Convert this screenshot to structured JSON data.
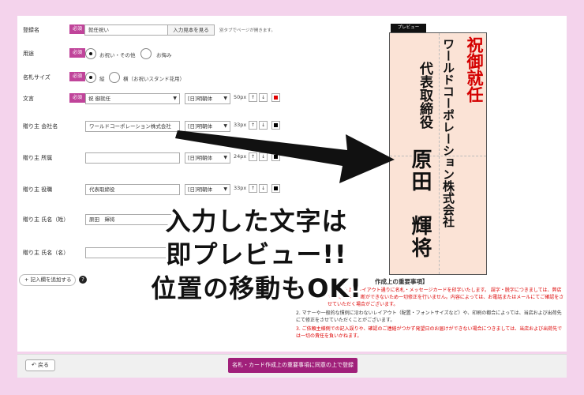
{
  "form": {
    "required": "必須",
    "rows": [
      {
        "label": "登録名",
        "required": true,
        "value": "就任祝い",
        "button": "入力見本を見る",
        "note": "別タブでページが開きます。"
      },
      {
        "label": "用途",
        "required": true,
        "options": [
          "お祝い・その他",
          "お悔み"
        ],
        "selected": 0
      },
      {
        "label": "名札サイズ",
        "required": true,
        "options": [
          "縦",
          "横（お祝いスタンド花用）"
        ],
        "selected": 0
      },
      {
        "label": "文言",
        "required": true,
        "value": "祝 御就任",
        "font": "[日]明朝体",
        "size": "50px",
        "color": "#e00000"
      },
      {
        "label": "贈り主 会社名",
        "required": false,
        "value": "ワールドコーポレーション株式会社",
        "font": "[日]明朝体",
        "size": "33px",
        "color": "#000000"
      },
      {
        "label": "贈り主 所属",
        "required": false,
        "value": "",
        "font": "[日]明朝体",
        "size": "24px",
        "color": "#000000"
      },
      {
        "label": "贈り主 役職",
        "required": false,
        "value": "代表取締役",
        "font": "[日]明朝体",
        "size": "33px",
        "color": "#000000"
      },
      {
        "label": "贈り主 氏名（姓）",
        "required": false,
        "value": "原田　輝将"
      },
      {
        "label": "贈り主 氏名（名）",
        "required": false,
        "value": ""
      }
    ],
    "add_field": "記入欄を追加する"
  },
  "preview": {
    "tab": "プレビュー",
    "line1": "祝御就任",
    "line2": "ワールドコーポレーション株式会社",
    "line3": "代表取締役",
    "line4": "原田　輝将"
  },
  "overlay": [
    "入力した文字は",
    "即プレビュー!!",
    "位置の移動もOK!"
  ],
  "notes": {
    "title": "作成上の重要事項】",
    "items": [
      "だいた上記レイアウト通りに名札・メッセージカードを印字いたします。 誤字・脱字につきましては、弊店での責任的な判断ができないため一切修正を行いません。内容によっては、お電話またはメールにてご確認をさせていただく場合がございます。",
      "マナーや一般的な慣例に沿わないレイアウト（配置・フォントサイズなど）や、印刷の都合によっては、当店および出荷先にて修正をさせていただくことがございます。",
      "ご依頼主様側での記入誤りや、確認のご連絡がつかず発望日のお届けができない場合につきましては、当店および出荷先では一切の責任を負いかねます。"
    ]
  },
  "footer": {
    "back": "戻る",
    "submit": "名札・カード作成上の重要事項に同意の上で登録"
  },
  "colors": {
    "accent": "#c0449a",
    "background": "#f4d3ec",
    "card": "#fbe3d6"
  }
}
